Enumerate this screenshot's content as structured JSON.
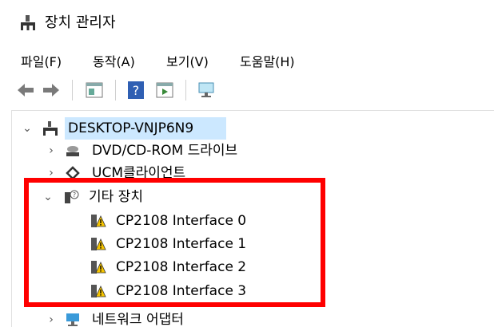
{
  "window": {
    "title": "장치 관리자"
  },
  "menu": [
    "파일(F)",
    "동작(A)",
    "보기(V)",
    "도움말(H)"
  ],
  "toolbar": {
    "buttons": [
      "back-icon",
      "forward-icon",
      "properties-icon",
      "help-icon",
      "view-icon",
      "scan-hardware-icon"
    ]
  },
  "tree": {
    "root": "DESKTOP-VNJP6N9",
    "dvd": "DVD/CD-ROM 드라이브",
    "ucm": "UCM클라이언트",
    "other": "기타 장치",
    "devices": [
      "CP2108 Interface 0",
      "CP2108 Interface 1",
      "CP2108 Interface 2",
      "CP2108 Interface 3"
    ],
    "network": "네트워크 어댑터"
  },
  "colors": {
    "highlight": "#ff0000",
    "selection": "#cce8ff",
    "warning": "#f5c400"
  }
}
